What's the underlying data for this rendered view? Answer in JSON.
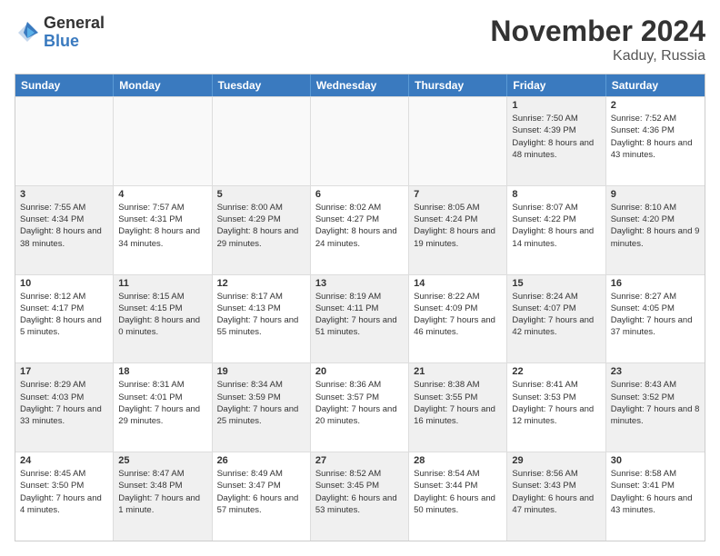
{
  "logo": {
    "general": "General",
    "blue": "Blue"
  },
  "header": {
    "month": "November 2024",
    "location": "Kaduy, Russia"
  },
  "weekdays": [
    "Sunday",
    "Monday",
    "Tuesday",
    "Wednesday",
    "Thursday",
    "Friday",
    "Saturday"
  ],
  "rows": [
    [
      {
        "day": "",
        "text": "",
        "empty": true
      },
      {
        "day": "",
        "text": "",
        "empty": true
      },
      {
        "day": "",
        "text": "",
        "empty": true
      },
      {
        "day": "",
        "text": "",
        "empty": true
      },
      {
        "day": "",
        "text": "",
        "empty": true
      },
      {
        "day": "1",
        "text": "Sunrise: 7:50 AM\nSunset: 4:39 PM\nDaylight: 8 hours and 48 minutes.",
        "shaded": true
      },
      {
        "day": "2",
        "text": "Sunrise: 7:52 AM\nSunset: 4:36 PM\nDaylight: 8 hours and 43 minutes.",
        "shaded": false
      }
    ],
    [
      {
        "day": "3",
        "text": "Sunrise: 7:55 AM\nSunset: 4:34 PM\nDaylight: 8 hours and 38 minutes.",
        "shaded": true
      },
      {
        "day": "4",
        "text": "Sunrise: 7:57 AM\nSunset: 4:31 PM\nDaylight: 8 hours and 34 minutes.",
        "shaded": false
      },
      {
        "day": "5",
        "text": "Sunrise: 8:00 AM\nSunset: 4:29 PM\nDaylight: 8 hours and 29 minutes.",
        "shaded": true
      },
      {
        "day": "6",
        "text": "Sunrise: 8:02 AM\nSunset: 4:27 PM\nDaylight: 8 hours and 24 minutes.",
        "shaded": false
      },
      {
        "day": "7",
        "text": "Sunrise: 8:05 AM\nSunset: 4:24 PM\nDaylight: 8 hours and 19 minutes.",
        "shaded": true
      },
      {
        "day": "8",
        "text": "Sunrise: 8:07 AM\nSunset: 4:22 PM\nDaylight: 8 hours and 14 minutes.",
        "shaded": false
      },
      {
        "day": "9",
        "text": "Sunrise: 8:10 AM\nSunset: 4:20 PM\nDaylight: 8 hours and 9 minutes.",
        "shaded": true
      }
    ],
    [
      {
        "day": "10",
        "text": "Sunrise: 8:12 AM\nSunset: 4:17 PM\nDaylight: 8 hours and 5 minutes.",
        "shaded": false
      },
      {
        "day": "11",
        "text": "Sunrise: 8:15 AM\nSunset: 4:15 PM\nDaylight: 8 hours and 0 minutes.",
        "shaded": true
      },
      {
        "day": "12",
        "text": "Sunrise: 8:17 AM\nSunset: 4:13 PM\nDaylight: 7 hours and 55 minutes.",
        "shaded": false
      },
      {
        "day": "13",
        "text": "Sunrise: 8:19 AM\nSunset: 4:11 PM\nDaylight: 7 hours and 51 minutes.",
        "shaded": true
      },
      {
        "day": "14",
        "text": "Sunrise: 8:22 AM\nSunset: 4:09 PM\nDaylight: 7 hours and 46 minutes.",
        "shaded": false
      },
      {
        "day": "15",
        "text": "Sunrise: 8:24 AM\nSunset: 4:07 PM\nDaylight: 7 hours and 42 minutes.",
        "shaded": true
      },
      {
        "day": "16",
        "text": "Sunrise: 8:27 AM\nSunset: 4:05 PM\nDaylight: 7 hours and 37 minutes.",
        "shaded": false
      }
    ],
    [
      {
        "day": "17",
        "text": "Sunrise: 8:29 AM\nSunset: 4:03 PM\nDaylight: 7 hours and 33 minutes.",
        "shaded": true
      },
      {
        "day": "18",
        "text": "Sunrise: 8:31 AM\nSunset: 4:01 PM\nDaylight: 7 hours and 29 minutes.",
        "shaded": false
      },
      {
        "day": "19",
        "text": "Sunrise: 8:34 AM\nSunset: 3:59 PM\nDaylight: 7 hours and 25 minutes.",
        "shaded": true
      },
      {
        "day": "20",
        "text": "Sunrise: 8:36 AM\nSunset: 3:57 PM\nDaylight: 7 hours and 20 minutes.",
        "shaded": false
      },
      {
        "day": "21",
        "text": "Sunrise: 8:38 AM\nSunset: 3:55 PM\nDaylight: 7 hours and 16 minutes.",
        "shaded": true
      },
      {
        "day": "22",
        "text": "Sunrise: 8:41 AM\nSunset: 3:53 PM\nDaylight: 7 hours and 12 minutes.",
        "shaded": false
      },
      {
        "day": "23",
        "text": "Sunrise: 8:43 AM\nSunset: 3:52 PM\nDaylight: 7 hours and 8 minutes.",
        "shaded": true
      }
    ],
    [
      {
        "day": "24",
        "text": "Sunrise: 8:45 AM\nSunset: 3:50 PM\nDaylight: 7 hours and 4 minutes.",
        "shaded": false
      },
      {
        "day": "25",
        "text": "Sunrise: 8:47 AM\nSunset: 3:48 PM\nDaylight: 7 hours and 1 minute.",
        "shaded": true
      },
      {
        "day": "26",
        "text": "Sunrise: 8:49 AM\nSunset: 3:47 PM\nDaylight: 6 hours and 57 minutes.",
        "shaded": false
      },
      {
        "day": "27",
        "text": "Sunrise: 8:52 AM\nSunset: 3:45 PM\nDaylight: 6 hours and 53 minutes.",
        "shaded": true
      },
      {
        "day": "28",
        "text": "Sunrise: 8:54 AM\nSunset: 3:44 PM\nDaylight: 6 hours and 50 minutes.",
        "shaded": false
      },
      {
        "day": "29",
        "text": "Sunrise: 8:56 AM\nSunset: 3:43 PM\nDaylight: 6 hours and 47 minutes.",
        "shaded": true
      },
      {
        "day": "30",
        "text": "Sunrise: 8:58 AM\nSunset: 3:41 PM\nDaylight: 6 hours and 43 minutes.",
        "shaded": false
      }
    ]
  ]
}
